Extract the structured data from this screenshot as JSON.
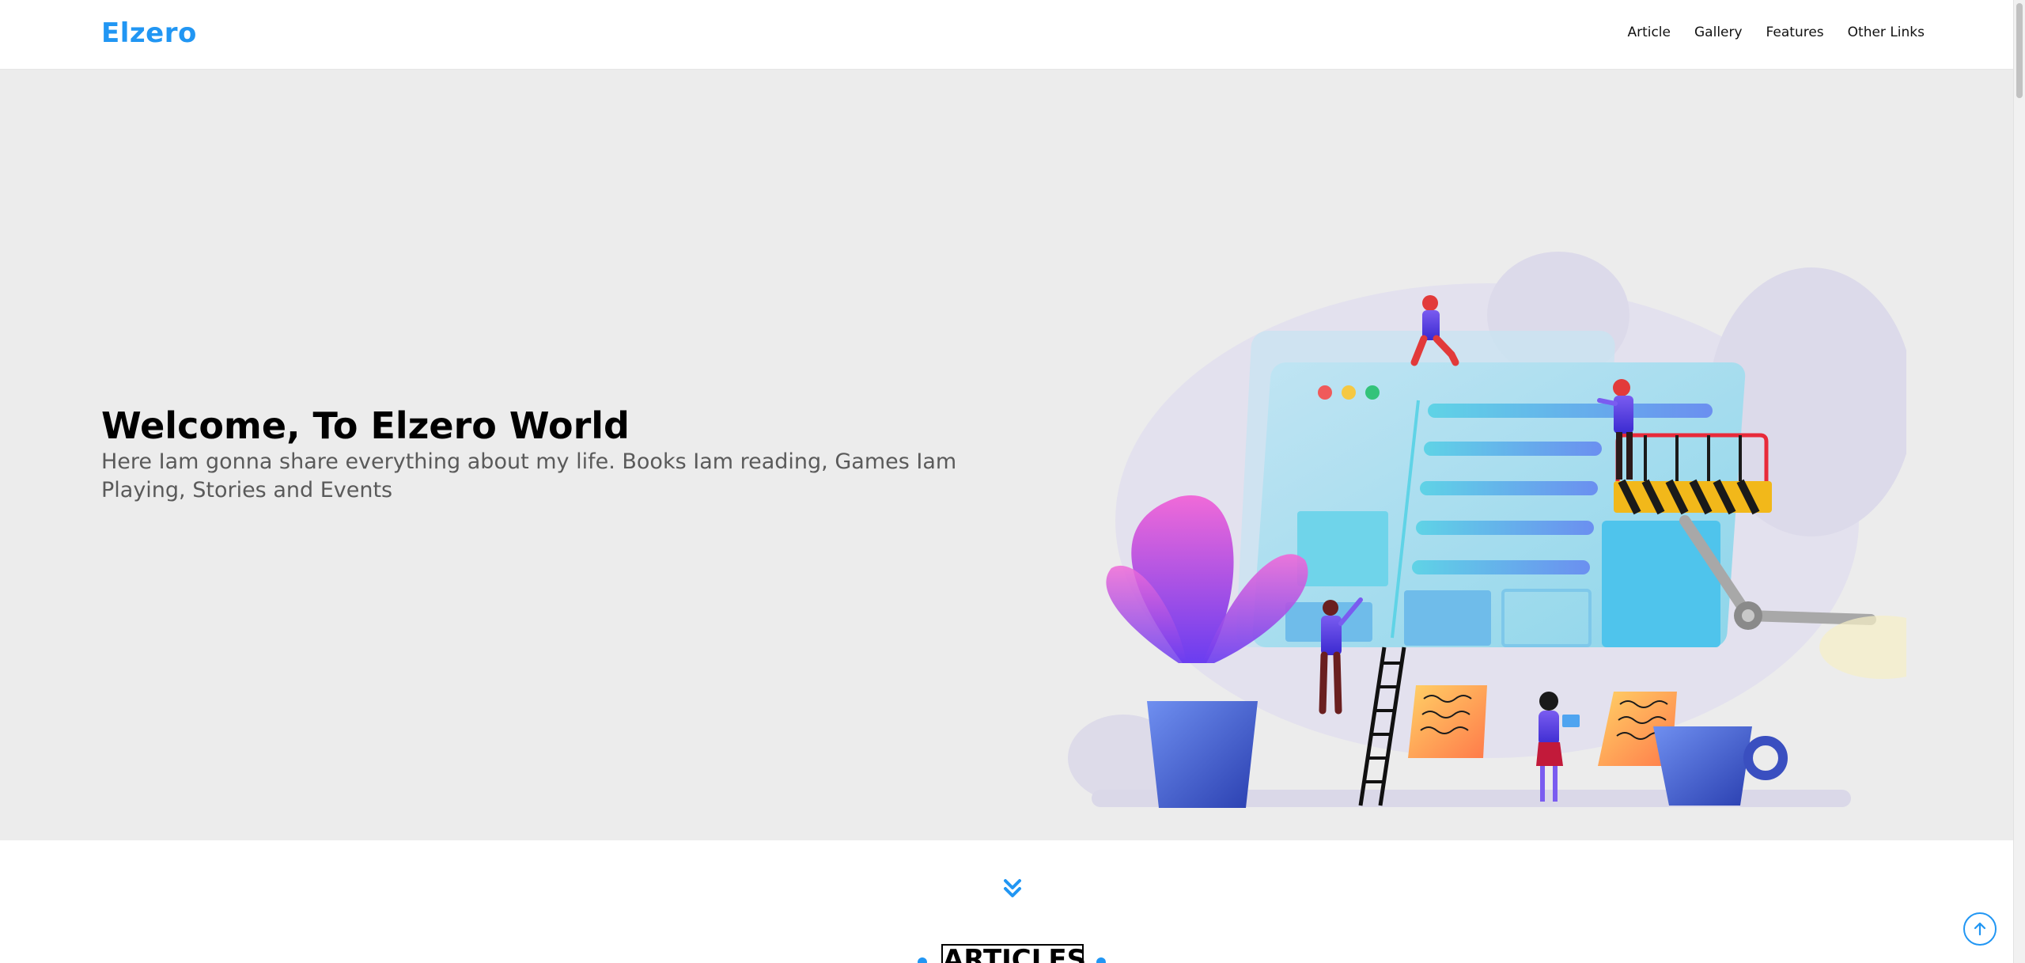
{
  "header": {
    "logo": "Elzero",
    "nav": [
      {
        "label": "Article"
      },
      {
        "label": "Gallery"
      },
      {
        "label": "Features"
      },
      {
        "label": "Other Links"
      }
    ]
  },
  "hero": {
    "title": "Welcome, To Elzero World",
    "text": "Here Iam gonna share everything about my life. Books Iam reading, Games Iam Playing, Stories and Events",
    "illustration": "website-construction-illustration"
  },
  "sections": {
    "articles_title": "ARTICLES"
  },
  "icons": {
    "scroll_down": "double-chevron-down-icon",
    "back_to_top": "arrow-up-icon"
  },
  "colors": {
    "brand": "#2196f3",
    "hero_bg": "#ececec",
    "text_dark": "#000000",
    "text_muted": "#5a5a5a"
  }
}
